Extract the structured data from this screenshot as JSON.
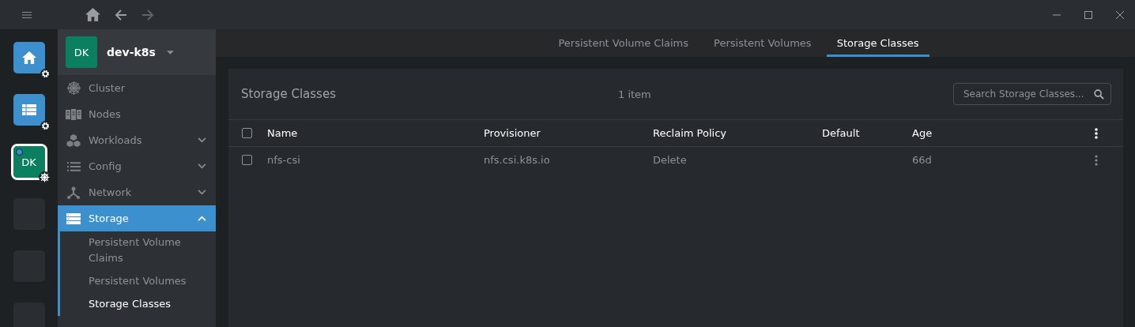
{
  "hotbar": [
    {
      "kind": "home",
      "selected": false
    },
    {
      "kind": "list",
      "selected": false
    },
    {
      "kind": "cluster",
      "label": "DK",
      "selected": true,
      "color": "#0a8060"
    },
    {
      "kind": "empty",
      "selected": false
    },
    {
      "kind": "empty",
      "selected": false
    },
    {
      "kind": "empty",
      "selected": false
    }
  ],
  "cluster": {
    "avatar": "DK",
    "name": "dev-k8s"
  },
  "sidebar": {
    "items": [
      {
        "label": "Cluster",
        "selected": false
      },
      {
        "label": "Nodes",
        "selected": false
      },
      {
        "label": "Workloads",
        "selected": false,
        "expanded": false
      },
      {
        "label": "Config",
        "selected": false,
        "expanded": false
      },
      {
        "label": "Network",
        "selected": false,
        "expanded": false
      },
      {
        "label": "Storage",
        "selected": true,
        "expanded": true,
        "children": [
          {
            "label": "Persistent Volume Claims",
            "selected": false
          },
          {
            "label": "Persistent Volumes",
            "selected": false
          },
          {
            "label": "Storage Classes",
            "selected": true
          }
        ]
      }
    ]
  },
  "tabs": [
    {
      "label": "Persistent Volume Claims",
      "selected": false
    },
    {
      "label": "Persistent Volumes",
      "selected": false
    },
    {
      "label": "Storage Classes",
      "selected": true
    }
  ],
  "panel": {
    "title": "Storage Classes",
    "count": "1 item",
    "search": {
      "placeholder": "Search Storage Classes..."
    }
  },
  "table": {
    "columns": [
      "Name",
      "Provisioner",
      "Reclaim Policy",
      "Default",
      "Age"
    ],
    "rows": [
      {
        "checked": false,
        "cells": [
          "nfs-csi",
          "nfs.csi.k8s.io",
          "Delete",
          "",
          "66d"
        ]
      }
    ]
  },
  "header_checked": false
}
